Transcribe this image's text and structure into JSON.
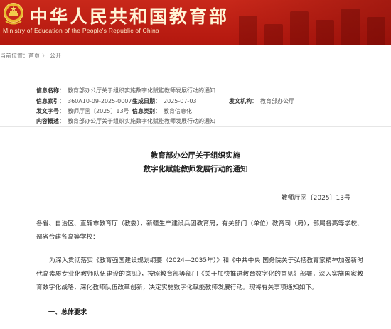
{
  "header": {
    "site_title": "中华人民共和国教育部",
    "site_subtitle": "Ministry of Education of the People's Republic of China",
    "emblem_icon": "national-emblem-icon",
    "colors": {
      "banner": "#b3170e",
      "title_text": "#fff4d6"
    }
  },
  "breadcrumb": {
    "prefix": "当前位置：",
    "home": "首页",
    "separator": "〉",
    "current": "公开"
  },
  "meta": {
    "name_label": "信息名称",
    "name_value": "教育部办公厅关于组织实施数字化赋能教师发展行动的通知",
    "index_label": "信息索引",
    "index_value": "360A10-09-2025-0007-1",
    "date_label": "生成日期",
    "date_value": "2025-07-03",
    "issuer_label": "发文机构",
    "issuer_value": "教育部办公厅",
    "docno_label": "发文字号",
    "docno_value": "教师厅函〔2025〕13号",
    "category_label": "信息类别",
    "category_value": "教育信息化",
    "summary_label": "内容概述",
    "summary_value": "教育部办公厅关于组织实施数字化赋能教师发展行动的通知"
  },
  "document": {
    "title_line1": "教育部办公厅关于组织实施",
    "title_line2": "数字化赋能教师发展行动的通知",
    "doc_number": "教师厅函〔2025〕13号",
    "recipients": "各省、自治区、直辖市教育厅（教委），新疆生产建设兵团教育局，有关部门（单位）教育司（局），部属各高等学校、部省合建各高等学校：",
    "intro": "为深入贯彻落实《教育强国建设规划纲要（2024—2035年）》和《中共中央 国务院关于弘扬教育家精神加强新时代高素质专业化教师队伍建设的意见》，按照教育部等部门《关于加快推进教育数字化的意见》部署，深入实施国家教育数字化战略，深化教师队伍改革创新，决定实施数字化赋能教师发展行动。现将有关事项通知如下。",
    "section1": "一、总体要求"
  }
}
